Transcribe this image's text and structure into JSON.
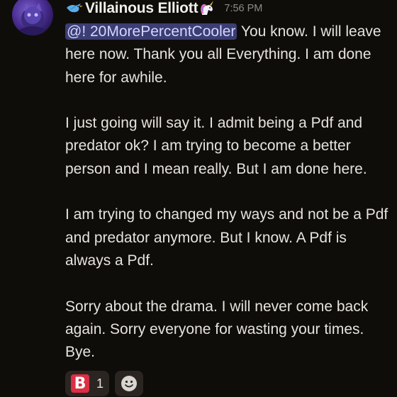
{
  "message": {
    "username_prefix_icon": "bird-emoji-icon",
    "username": "Villainous Elliott",
    "username_suffix_icon": "unicorn-emoji-icon",
    "timestamp": "7:56 PM",
    "mention": "@! 20MorePercentCooler",
    "paragraphs": [
      " You know. I will leave here now. Thank you all Everything. I am done here for awhile.",
      "I just going will say it. I admit being a Pdf and predator ok? I am trying to become a better person and I mean really. But I am done here.",
      "I am trying to changed my ways and not be a Pdf and predator anymore. But I know. A Pdf is always a Pdf.",
      "Sorry about the drama. I will never come back again. Sorry everyone for wasting your times. Bye."
    ]
  },
  "reactions": [
    {
      "emoji": "B",
      "emoji_icon": "b-button-emoji-icon",
      "count": "1"
    }
  ],
  "add_reaction_icon": "smiley-face-icon",
  "colors": {
    "background": "#0f0d0a",
    "mention_bg": "#3b3d73",
    "mention_text": "#d3d7ff",
    "reaction_bg": "#2a2520",
    "b_emoji_bg": "#dd2e44"
  }
}
